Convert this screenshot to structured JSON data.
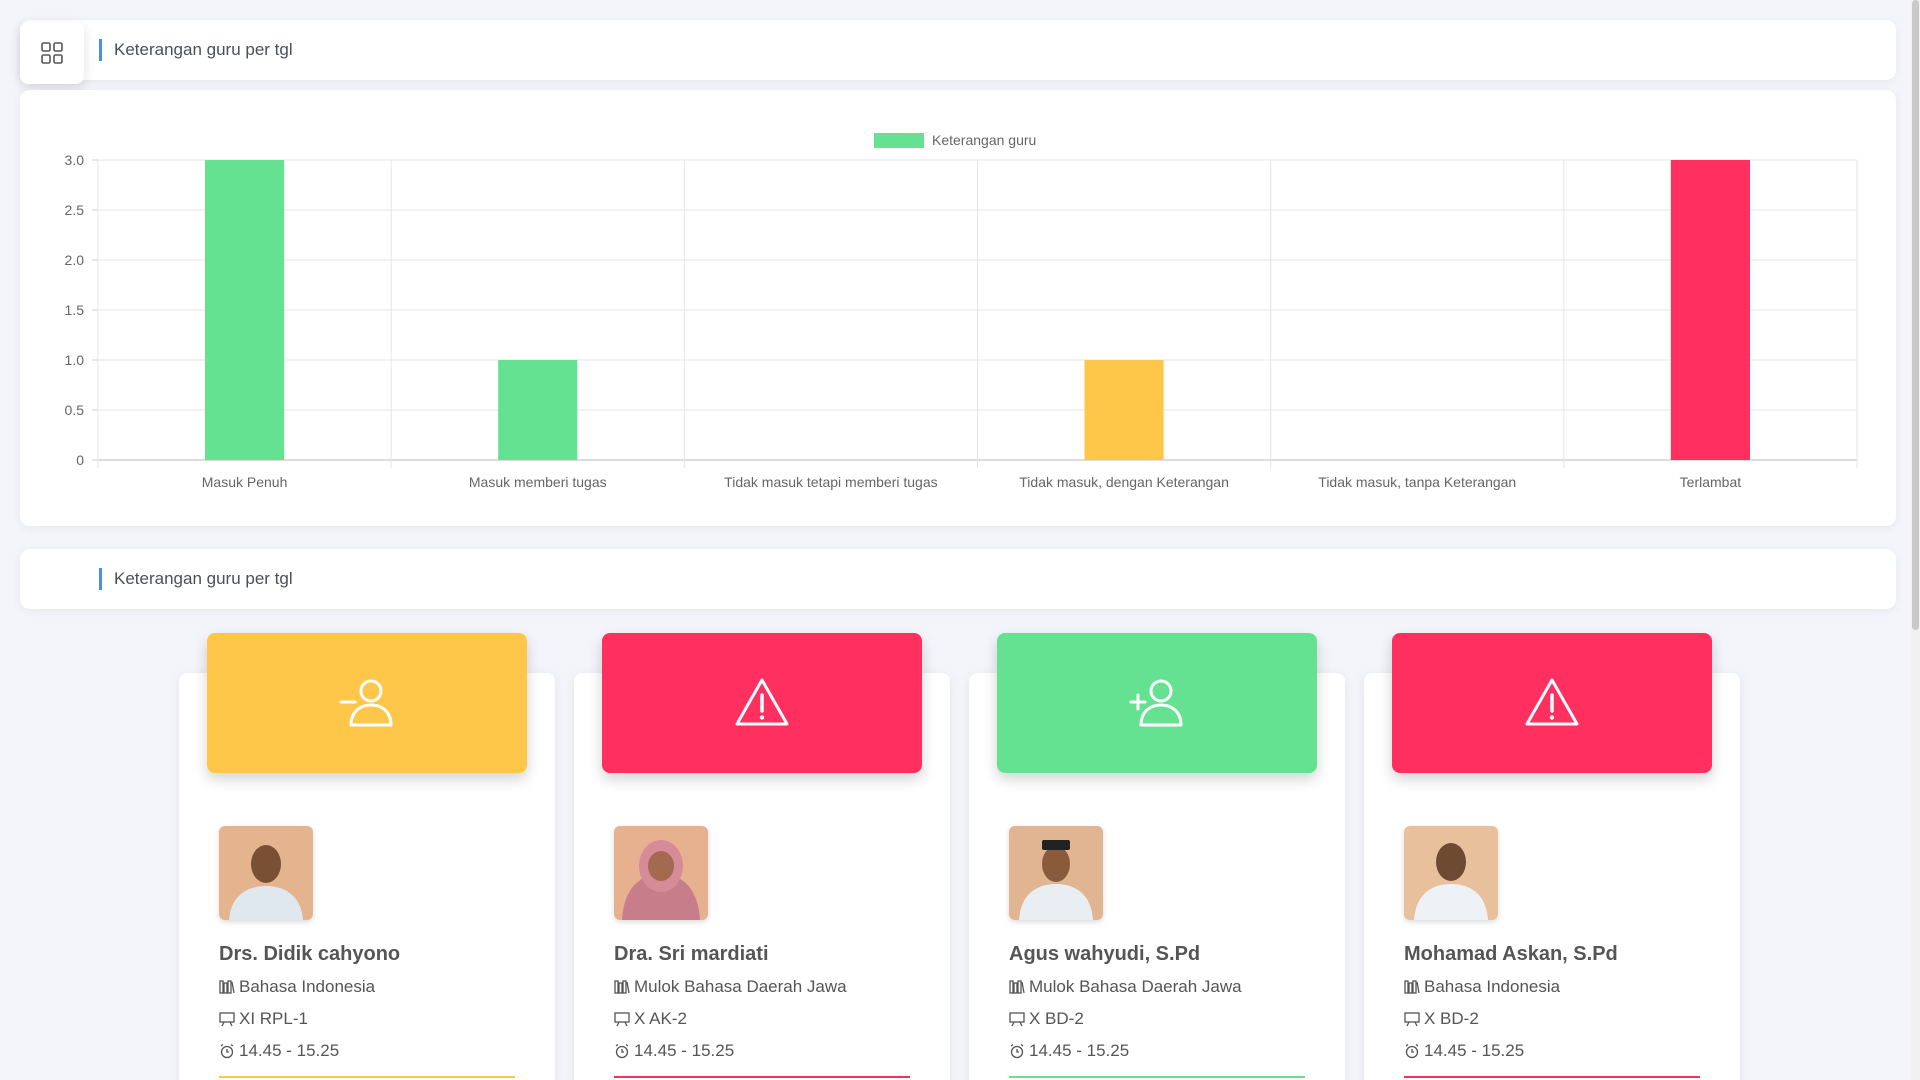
{
  "header": {
    "title": "Keterangan guru per tgl",
    "menu_icon": "grid-icon"
  },
  "section2": {
    "title": "Keterangan guru per tgl"
  },
  "chart_data": {
    "type": "bar",
    "legend": "Keterangan guru",
    "legend_color": "#64e291",
    "categories": [
      "Masuk Penuh",
      "Masuk memberi tugas",
      "Tidak masuk tetapi memberi tugas",
      "Tidak masuk, dengan Keterangan",
      "Tidak masuk, tanpa Keterangan",
      "Terlambat"
    ],
    "values": [
      3,
      1,
      0,
      1,
      0,
      3
    ],
    "colors": [
      "#64e291",
      "#64e291",
      "#64e291",
      "#ffc74a",
      "#ff2f5f",
      "#ff2f5f"
    ],
    "ylim": [
      0,
      3
    ],
    "yticks": [
      "0",
      "0.5",
      "1.0",
      "1.5",
      "2.0",
      "2.5",
      "3.0"
    ],
    "grid": true,
    "legend_position": "top"
  },
  "cards": [
    {
      "name": "Drs. Didik cahyono",
      "subject": "Bahasa Indonesia",
      "class": "XI RPL-1",
      "time": "14.45 - 15.25",
      "color": "#ffc74a",
      "icon": "user-minus-icon"
    },
    {
      "name": "Dra. Sri mardiati",
      "subject": "Mulok Bahasa Daerah Jawa",
      "class": "X AK-2",
      "time": "14.45 - 15.25",
      "color": "#ff2f5f",
      "icon": "warning-icon"
    },
    {
      "name": "Agus wahyudi, S.Pd",
      "subject": "Mulok Bahasa Daerah Jawa",
      "class": "X BD-2",
      "time": "14.45 - 15.25",
      "color": "#64e291",
      "icon": "user-plus-icon"
    },
    {
      "name": "Mohamad Askan, S.Pd",
      "subject": "Bahasa Indonesia",
      "class": "X BD-2",
      "time": "14.45 - 15.25",
      "color": "#ff2f5f",
      "icon": "warning-icon"
    }
  ]
}
